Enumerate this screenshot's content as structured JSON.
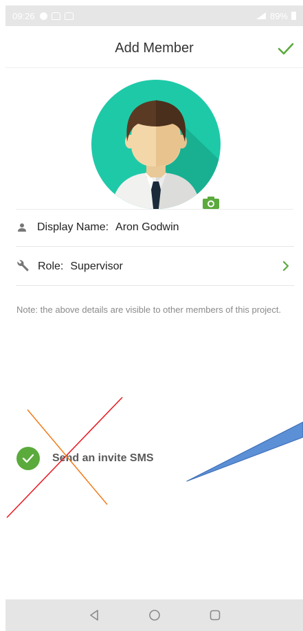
{
  "status_bar": {
    "time": "09:26",
    "battery": "89%"
  },
  "header": {
    "title": "Add Member",
    "confirm_icon": "checkmark-icon"
  },
  "avatar": {
    "icon": "avatar-icon",
    "camera_icon": "camera-icon"
  },
  "form": {
    "display_name_label": "Display Name:",
    "display_name_value": "Aron Godwin",
    "role_label": "Role:",
    "role_value": "Supervisor"
  },
  "note": "Note: the above details are visible to other members of this project.",
  "invite": {
    "label": "Send an invite SMS",
    "checked": true
  },
  "colors": {
    "accent": "#5aaa3c",
    "avatar_bg": "#1ec9a8",
    "annotation_red": "#e8141c",
    "annotation_orange": "#f07a1a",
    "annotation_blue": "#5b8fd6"
  },
  "nav_bar": {
    "icons": [
      "back-icon",
      "home-icon",
      "recents-icon"
    ]
  }
}
